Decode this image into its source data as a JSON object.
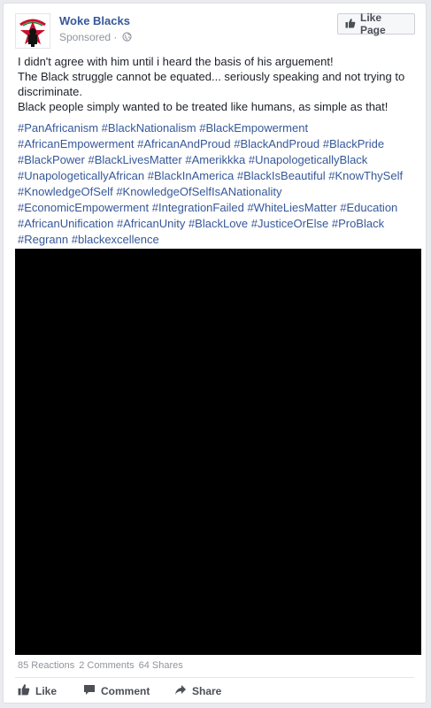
{
  "post": {
    "page_name": "Woke Blacks",
    "sponsored_label": "Sponsored",
    "separator": "·",
    "like_page_label": "Like Page",
    "message_lines": [
      "I didn't agree with him until i heard the basis of his arguement!",
      "The Black struggle cannot be equated... seriously speaking and not trying to discriminate.",
      "Black people simply wanted to be treated like humans, as simple as that!"
    ],
    "hashtags": [
      "#PanAfricanism",
      "#BlackNationalism",
      "#BlackEmpowerment",
      "#AfricanEmpowerment",
      "#AfricanAndProud",
      "#BlackAndProud",
      "#BlackPride",
      "#BlackPower",
      "#BlackLivesMatter",
      "#Amerikkka",
      "#UnapologeticallyBlack",
      "#UnapologeticallyAfrican",
      "#BlackInAmerica",
      "#BlackIsBeautiful",
      "#KnowThySelf",
      "#KnowledgeOfSelf",
      "#KnowledgeOfSelfIsANationality",
      "#EconomicEmpowerment",
      "#IntegrationFailed",
      "#WhiteLiesMatter",
      "#Education",
      "#AfricanUnification",
      "#AfricanUnity",
      "#BlackLove",
      "#JusticeOrElse",
      "#ProBlack",
      "#Regrann",
      "#blackexcellence"
    ],
    "hashtag_line_breaks": [
      3,
      7,
      11,
      15,
      17,
      21,
      26
    ],
    "stats": {
      "reactions": "85 Reactions",
      "comments": "2 Comments",
      "shares": "64 Shares"
    },
    "actions": {
      "like": "Like",
      "comment": "Comment",
      "share": "Share"
    }
  },
  "icons": {
    "avatar": "woke-blacks-logo",
    "globe": "globe-icon",
    "thumbs_up": "thumbs-up-icon",
    "comment": "comment-icon",
    "share": "share-icon"
  },
  "colors": {
    "link": "#365899",
    "muted": "#90949c",
    "text": "#1d2129",
    "button_text": "#4b4f56",
    "logo_red": "#c8102e",
    "logo_green": "#1b8a3a"
  }
}
